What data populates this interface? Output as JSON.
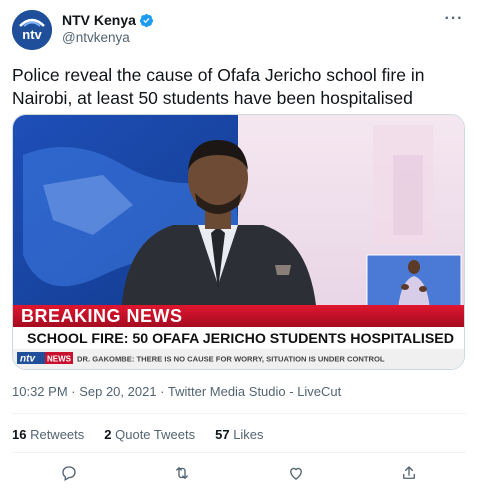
{
  "account": {
    "display_name": "NTV Kenya",
    "handle": "@ntvkenya",
    "logo_text": "ntv"
  },
  "tweet": {
    "text": "Police reveal the cause of Ofafa Jericho school fire in Nairobi, at least 50 students have been hospitalised",
    "meta": "10:32 PM · Sep 20, 2021 · Twitter Media Studio - LiveCut"
  },
  "video": {
    "breaking_label": "BREAKING NEWS",
    "headline": "SCHOOL FIRE: 50 OFAFA JERICHO STUDENTS HOSPITALISED",
    "ticker_brand": "ntv",
    "ticker_news": "NEWS",
    "ticker_text": "DR. GAKOMBE: THERE IS NO CAUSE FOR WORRY, SITUATION IS UNDER CONTROL"
  },
  "stats": {
    "retweets_count": "16",
    "retweets_label": " Retweets",
    "quotes_count": "2",
    "quotes_label": " Quote Tweets",
    "likes_count": "57",
    "likes_label": " Likes"
  },
  "colors": {
    "accent": "#1d9bf0",
    "breaking_red": "#c8102e",
    "ntv_blue": "#1f4f9a"
  }
}
